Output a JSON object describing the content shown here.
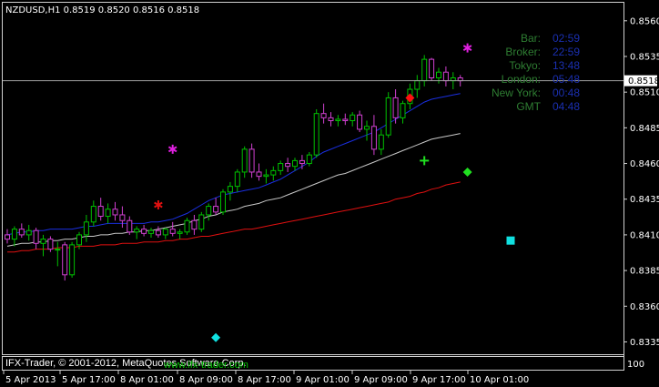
{
  "header": {
    "symbol_info": "NZDUSD,H1  0.8519 0.8520 0.8516 0.8518"
  },
  "current_price_label": "0.8518",
  "price_axis": [
    "0.8560",
    "0.8535",
    "0.8510",
    "0.8485",
    "0.8460",
    "0.8435",
    "0.8410",
    "0.8385",
    "0.8360",
    "0.8335"
  ],
  "time_axis": [
    "5 Apr 2013",
    "5 Apr 17:00",
    "8 Apr 01:00",
    "8 Apr 09:00",
    "8 Apr 17:00",
    "9 Apr 01:00",
    "9 Apr 09:00",
    "9 Apr 17:00",
    "10 Apr 01:00"
  ],
  "clock": {
    "rows": [
      {
        "label": "Bar:",
        "value": "02:59"
      },
      {
        "label": "Broker:",
        "value": "22:59"
      },
      {
        "label": "Tokyo:",
        "value": "13:48"
      },
      {
        "label": "London:",
        "value": "05:48"
      },
      {
        "label": "New York:",
        "value": "00:48"
      },
      {
        "label": "GMT",
        "value": "04:48"
      }
    ]
  },
  "footer": {
    "copyright": "IFX-Trader, © 2001-2012, MetaQuotes Software Corp.",
    "overlay_text": "www.ifx-trader.com",
    "subwindow_value": "100"
  },
  "colors": {
    "background": "#000000",
    "bull_candle": "#00c000",
    "bear_candle": "#d040d0",
    "ma_fast": "#1a2fe0",
    "ma_mid": "#c8c8c8",
    "ma_slow": "#e01010",
    "clock_label": "#2e7d32",
    "clock_value": "#1a2fb0"
  },
  "chart_data": {
    "type": "candlestick",
    "symbol": "NZDUSD",
    "timeframe": "H1",
    "last_price": 0.8518,
    "ylim": [
      0.8327,
      0.8572
    ],
    "candles": [
      [
        0.841,
        0.8414,
        0.8404,
        0.8407
      ],
      [
        0.8407,
        0.8416,
        0.8402,
        0.8414
      ],
      [
        0.8414,
        0.8418,
        0.8408,
        0.841
      ],
      [
        0.841,
        0.8417,
        0.8406,
        0.8413
      ],
      [
        0.8413,
        0.8415,
        0.84,
        0.8404
      ],
      [
        0.8404,
        0.841,
        0.8395,
        0.8407
      ],
      [
        0.8407,
        0.8409,
        0.8398,
        0.84
      ],
      [
        0.84,
        0.8405,
        0.8388,
        0.84
      ],
      [
        0.8403,
        0.8405,
        0.8378,
        0.8382
      ],
      [
        0.8382,
        0.8405,
        0.838,
        0.8403
      ],
      [
        0.8403,
        0.8412,
        0.84,
        0.841
      ],
      [
        0.841,
        0.8424,
        0.8405,
        0.8419
      ],
      [
        0.8419,
        0.8434,
        0.8416,
        0.843
      ],
      [
        0.843,
        0.8436,
        0.842,
        0.8423
      ],
      [
        0.8423,
        0.8432,
        0.8418,
        0.8428
      ],
      [
        0.8428,
        0.8433,
        0.842,
        0.8424
      ],
      [
        0.8424,
        0.843,
        0.8415,
        0.842
      ],
      [
        0.842,
        0.8423,
        0.841,
        0.8412
      ],
      [
        0.8412,
        0.8416,
        0.8407,
        0.8414
      ],
      [
        0.8414,
        0.8417,
        0.8409,
        0.8411
      ],
      [
        0.8411,
        0.8415,
        0.8408,
        0.8413
      ],
      [
        0.8413,
        0.8416,
        0.8408,
        0.841
      ],
      [
        0.841,
        0.8415,
        0.8407,
        0.8414
      ],
      [
        0.8414,
        0.8419,
        0.8409,
        0.8411
      ],
      [
        0.8411,
        0.8414,
        0.8407,
        0.8412
      ],
      [
        0.8412,
        0.8422,
        0.841,
        0.842
      ],
      [
        0.842,
        0.8424,
        0.841,
        0.8414
      ],
      [
        0.8414,
        0.8426,
        0.8412,
        0.8424
      ],
      [
        0.8424,
        0.8432,
        0.842,
        0.843
      ],
      [
        0.843,
        0.8436,
        0.8424,
        0.8426
      ],
      [
        0.8426,
        0.8442,
        0.8424,
        0.844
      ],
      [
        0.844,
        0.8447,
        0.8434,
        0.8444
      ],
      [
        0.8444,
        0.8456,
        0.844,
        0.8454
      ],
      [
        0.8454,
        0.8472,
        0.845,
        0.847
      ],
      [
        0.847,
        0.8474,
        0.845,
        0.8454
      ],
      [
        0.8454,
        0.846,
        0.8448,
        0.8451
      ],
      [
        0.8451,
        0.8456,
        0.8446,
        0.8452
      ],
      [
        0.8452,
        0.8458,
        0.8448,
        0.8455
      ],
      [
        0.8455,
        0.8462,
        0.8452,
        0.846
      ],
      [
        0.846,
        0.8464,
        0.8454,
        0.8458
      ],
      [
        0.8458,
        0.8464,
        0.8455,
        0.8462
      ],
      [
        0.8462,
        0.8466,
        0.8456,
        0.846
      ],
      [
        0.846,
        0.8468,
        0.8458,
        0.8466
      ],
      [
        0.8466,
        0.8498,
        0.8464,
        0.8495
      ],
      [
        0.8495,
        0.8502,
        0.8488,
        0.8492
      ],
      [
        0.8492,
        0.8496,
        0.8486,
        0.849
      ],
      [
        0.849,
        0.8494,
        0.8486,
        0.8491
      ],
      [
        0.8491,
        0.8495,
        0.8487,
        0.849
      ],
      [
        0.849,
        0.8496,
        0.8486,
        0.8494
      ],
      [
        0.8494,
        0.8497,
        0.8482,
        0.8484
      ],
      [
        0.8484,
        0.849,
        0.8476,
        0.8486
      ],
      [
        0.8486,
        0.8494,
        0.8466,
        0.847
      ],
      [
        0.847,
        0.8484,
        0.8466,
        0.848
      ],
      [
        0.848,
        0.851,
        0.8478,
        0.8506
      ],
      [
        0.8506,
        0.8512,
        0.8488,
        0.8492
      ],
      [
        0.8492,
        0.8504,
        0.8488,
        0.8502
      ],
      [
        0.8502,
        0.8516,
        0.8498,
        0.8512
      ],
      [
        0.8512,
        0.8522,
        0.8506,
        0.8518
      ],
      [
        0.8518,
        0.8536,
        0.8514,
        0.8533
      ],
      [
        0.8533,
        0.8534,
        0.8518,
        0.852
      ],
      [
        0.852,
        0.8527,
        0.8516,
        0.8524
      ],
      [
        0.8524,
        0.8528,
        0.8514,
        0.8518
      ],
      [
        0.8518,
        0.8524,
        0.8512,
        0.852
      ],
      [
        0.852,
        0.8522,
        0.8514,
        0.8518
      ]
    ],
    "ma_fast": [
      0.841,
      0.8411,
      0.8412,
      0.8412,
      0.8413,
      0.8413,
      0.8414,
      0.8414,
      0.8414,
      0.8414,
      0.8415,
      0.8416,
      0.8416,
      0.8417,
      0.8418,
      0.8418,
      0.8418,
      0.8418,
      0.8418,
      0.8418,
      0.8419,
      0.8419,
      0.842,
      0.8421,
      0.8423,
      0.8425,
      0.8428,
      0.8431,
      0.8434,
      0.8436,
      0.8438,
      0.8439,
      0.844,
      0.8441,
      0.8442,
      0.8443,
      0.8445,
      0.8447,
      0.8449,
      0.8452,
      0.8455,
      0.8458,
      0.8461,
      0.8465,
      0.8468,
      0.847,
      0.8472,
      0.8474,
      0.8476,
      0.8478,
      0.848,
      0.8482,
      0.8485,
      0.8488,
      0.8491,
      0.8494,
      0.8497,
      0.85,
      0.8503,
      0.8505,
      0.8506,
      0.8507,
      0.8508,
      0.8509
    ],
    "ma_mid": [
      0.8402,
      0.8403,
      0.8404,
      0.8404,
      0.8405,
      0.8405,
      0.8406,
      0.8406,
      0.8407,
      0.8407,
      0.8408,
      0.8409,
      0.8409,
      0.841,
      0.841,
      0.8411,
      0.8411,
      0.8412,
      0.8412,
      0.8413,
      0.8413,
      0.8414,
      0.8415,
      0.8416,
      0.8417,
      0.8418,
      0.842,
      0.8421,
      0.8423,
      0.8424,
      0.8426,
      0.8427,
      0.8428,
      0.843,
      0.8431,
      0.8432,
      0.8434,
      0.8435,
      0.8436,
      0.8438,
      0.844,
      0.8442,
      0.8444,
      0.8446,
      0.8448,
      0.845,
      0.8452,
      0.8453,
      0.8455,
      0.8457,
      0.8459,
      0.8461,
      0.8463,
      0.8465,
      0.8467,
      0.8469,
      0.8471,
      0.8473,
      0.8475,
      0.8477,
      0.8478,
      0.8479,
      0.848,
      0.8481
    ],
    "ma_slow": [
      0.8398,
      0.8398,
      0.8399,
      0.8399,
      0.84,
      0.84,
      0.84,
      0.8401,
      0.8401,
      0.8401,
      0.8402,
      0.8402,
      0.8402,
      0.8403,
      0.8403,
      0.8403,
      0.8404,
      0.8404,
      0.8404,
      0.8405,
      0.8405,
      0.8405,
      0.8406,
      0.8406,
      0.8407,
      0.8407,
      0.8408,
      0.8409,
      0.8409,
      0.841,
      0.8411,
      0.8412,
      0.8413,
      0.8414,
      0.8414,
      0.8415,
      0.8416,
      0.8417,
      0.8418,
      0.8419,
      0.842,
      0.8421,
      0.8422,
      0.8423,
      0.8424,
      0.8425,
      0.8426,
      0.8427,
      0.8428,
      0.8429,
      0.843,
      0.8431,
      0.8432,
      0.8433,
      0.8435,
      0.8436,
      0.8437,
      0.8439,
      0.844,
      0.8442,
      0.8443,
      0.8445,
      0.8446,
      0.8447
    ],
    "markers": [
      {
        "shape": "star",
        "color": "#e020e0",
        "bar": 23,
        "price": 0.847
      },
      {
        "shape": "star",
        "color": "#e020e0",
        "bar": 64,
        "price": 0.8541
      },
      {
        "shape": "star",
        "color": "#e01010",
        "bar": 21,
        "price": 0.8431
      },
      {
        "shape": "diamond",
        "color": "#ff1010",
        "bar": 56,
        "price": 0.8506
      },
      {
        "shape": "plus",
        "color": "#20e020",
        "bar": 58,
        "price": 0.8462
      },
      {
        "shape": "diamond",
        "color": "#20e020",
        "bar": 64,
        "price": 0.8454
      },
      {
        "shape": "square",
        "color": "#10e0e0",
        "bar": 70,
        "price": 0.8406
      },
      {
        "shape": "diamond",
        "color": "#10e0e0",
        "bar": 29,
        "price": 0.8338
      }
    ]
  }
}
